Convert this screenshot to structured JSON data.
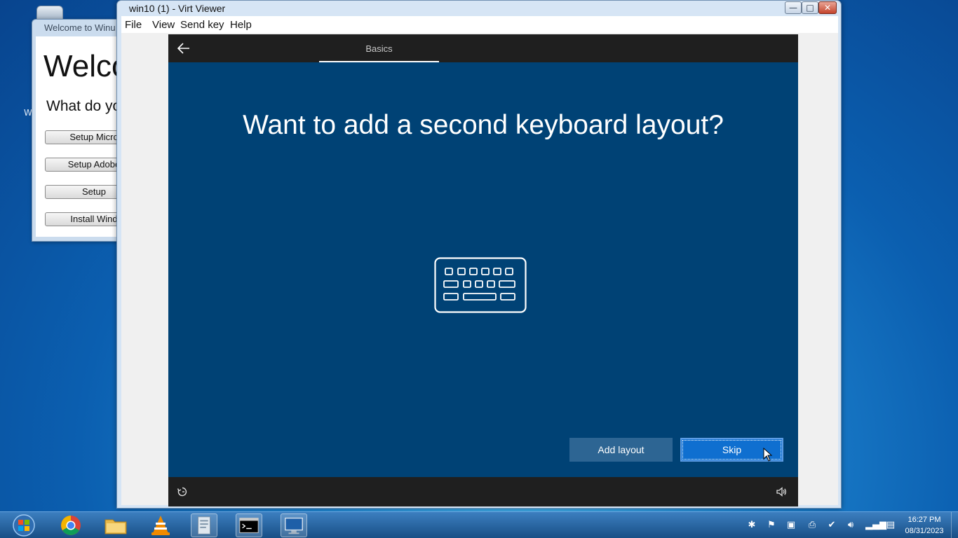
{
  "welcome_window": {
    "title": "Welcome to Winu",
    "heading": "Welco",
    "question": "What do yo",
    "buttons": [
      "Setup Micro",
      "Setup Adobe",
      "Setup",
      "Install Wind"
    ]
  },
  "desktop": {
    "side_text": "W"
  },
  "viewer": {
    "title": "win10 (1) - Virt Viewer",
    "menu": [
      "File",
      "View",
      "Send key",
      "Help"
    ],
    "controls": {
      "minimize": "—",
      "maximize": "□",
      "close": "✕"
    }
  },
  "guest": {
    "tab_label": "Basics",
    "heading": "Want to add a second keyboard layout?",
    "icon": "keyboard-icon",
    "add_layout_label": "Add layout",
    "skip_label": "Skip"
  },
  "taskbar": {
    "apps": [
      "chrome-icon",
      "file-explorer-icon",
      "vlc-icon",
      "document-app-icon",
      "command-prompt-icon",
      "virt-viewer-icon"
    ],
    "active_app": "virt-viewer-icon",
    "clock_time": "16:27 PM",
    "clock_date": "08/31/2023"
  }
}
